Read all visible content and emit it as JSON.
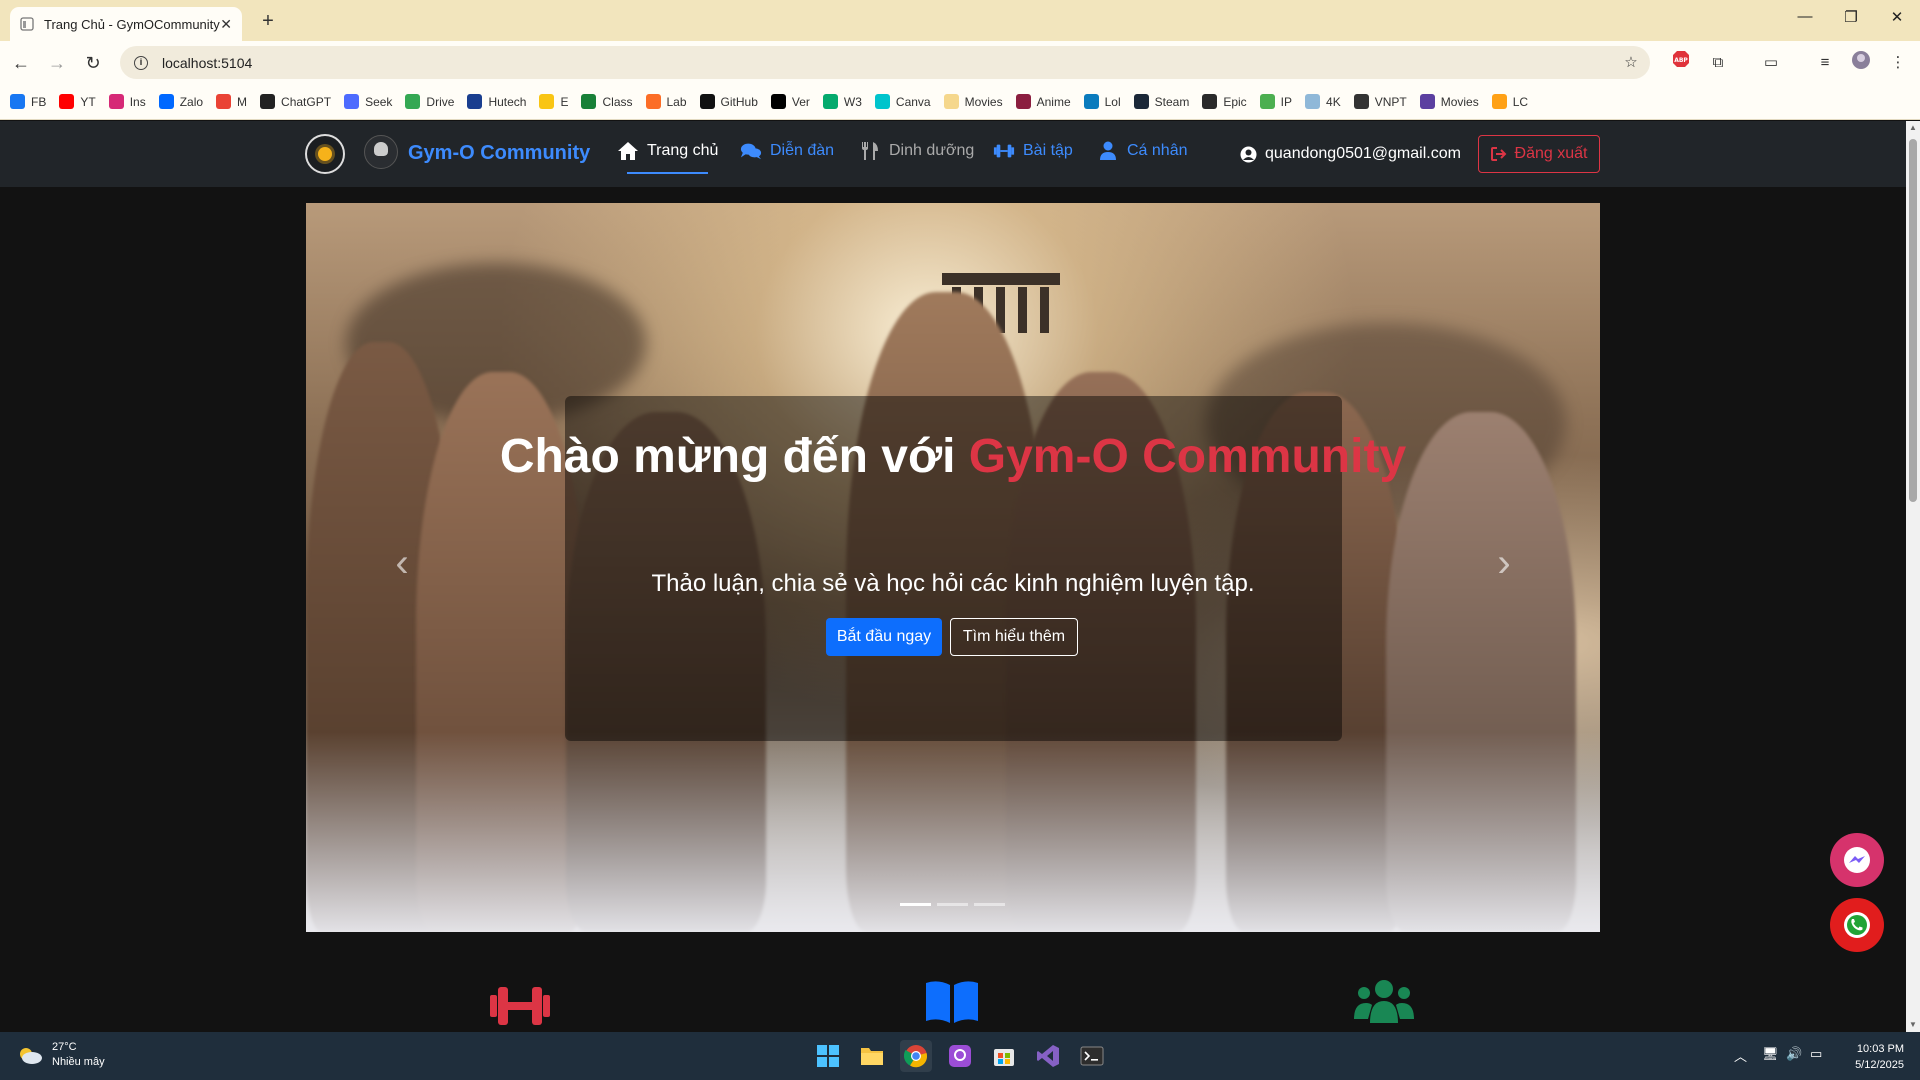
{
  "browser": {
    "tab_title": "Trang Chủ - GymOCommunity",
    "tab_close": "✕",
    "new_tab": "+",
    "url": "localhost:5104",
    "bookmarks": [
      {
        "label": "FB",
        "color": "#1877f2"
      },
      {
        "label": "YT",
        "color": "#ff0000"
      },
      {
        "label": "Ins",
        "color": "#d62976"
      },
      {
        "label": "Zalo",
        "color": "#0068ff"
      },
      {
        "label": "M",
        "color": "#ea4335"
      },
      {
        "label": "ChatGPT",
        "color": "#222222"
      },
      {
        "label": "Seek",
        "color": "#4d6bfe"
      },
      {
        "label": "Drive",
        "color": "#34a853"
      },
      {
        "label": "Hutech",
        "color": "#1a3e8f"
      },
      {
        "label": "E",
        "color": "#f9c513"
      },
      {
        "label": "Class",
        "color": "#188038"
      },
      {
        "label": "Lab",
        "color": "#fc6d26"
      },
      {
        "label": "GitHub",
        "color": "#111111"
      },
      {
        "label": "Ver",
        "color": "#000000"
      },
      {
        "label": "W3",
        "color": "#04aa6d"
      },
      {
        "label": "Canva",
        "color": "#00c4cc"
      },
      {
        "label": "Movies",
        "color": "#f5d78c"
      },
      {
        "label": "Anime",
        "color": "#8b1e3f"
      },
      {
        "label": "Lol",
        "color": "#0a7bbd"
      },
      {
        "label": "Steam",
        "color": "#1b2838"
      },
      {
        "label": "Epic",
        "color": "#2a2a2a"
      },
      {
        "label": "IP",
        "color": "#4caf50"
      },
      {
        "label": "4K",
        "color": "#8fb8d8"
      },
      {
        "label": "VNPT",
        "color": "#333333"
      },
      {
        "label": "Movies",
        "color": "#5b3fa0"
      },
      {
        "label": "LC",
        "color": "#ffa116"
      }
    ]
  },
  "nav": {
    "brand": "Gym-O Community",
    "links": [
      {
        "label": "Trang chủ",
        "icon": "home-icon"
      },
      {
        "label": "Diễn đàn",
        "icon": "comments-icon"
      },
      {
        "label": "Dinh dưỡng",
        "icon": "utensils-icon"
      },
      {
        "label": "Bài tập",
        "icon": "dumbbell-icon"
      },
      {
        "label": "Cá nhân",
        "icon": "user-icon"
      }
    ],
    "user_email": "quandong0501@gmail.com",
    "logout": "Đăng xuất"
  },
  "hero": {
    "title_prefix": "Chào mừng đến với ",
    "title_accent": "Gym-O Community",
    "subtitle": "Thảo luận, chia sẻ và học hỏi các kinh nghiệm luyện tập.",
    "btn_start": "Bắt đầu ngay",
    "btn_more": "Tìm hiểu thêm",
    "prev": "‹",
    "next": "›",
    "slide_count": 3,
    "active_slide": 1
  },
  "features": [
    {
      "icon": "dumbbell-icon",
      "color": "#dc3545"
    },
    {
      "icon": "book-icon",
      "color": "#0d6efd"
    },
    {
      "icon": "users-icon",
      "color": "#198754"
    }
  ],
  "taskbar": {
    "temperature": "27°C",
    "weather": "Nhiều mây",
    "time": "10:03 PM",
    "date": "5/12/2025"
  },
  "colors": {
    "accent_blue": "#3d8bfd",
    "accent_red": "#dc3545",
    "navbar_bg": "#212529"
  }
}
